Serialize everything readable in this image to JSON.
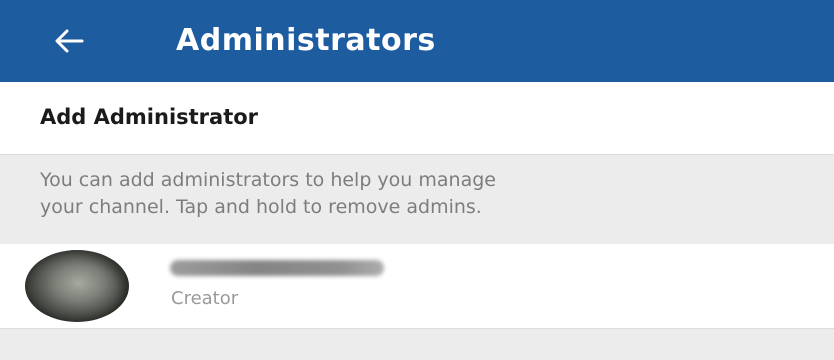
{
  "colors": {
    "app_bar": "#1e5ca0",
    "section_background": "#ececec",
    "secondary_text": "#7d7d7d"
  },
  "app_bar": {
    "back_icon": "arrow-left-icon",
    "title": "Administrators"
  },
  "add_admin": {
    "label": "Add Administrator"
  },
  "info": {
    "text": "You can add administrators to help you manage\nyour channel. Tap and hold to remove admins."
  },
  "admins": [
    {
      "role": "Creator"
    }
  ]
}
